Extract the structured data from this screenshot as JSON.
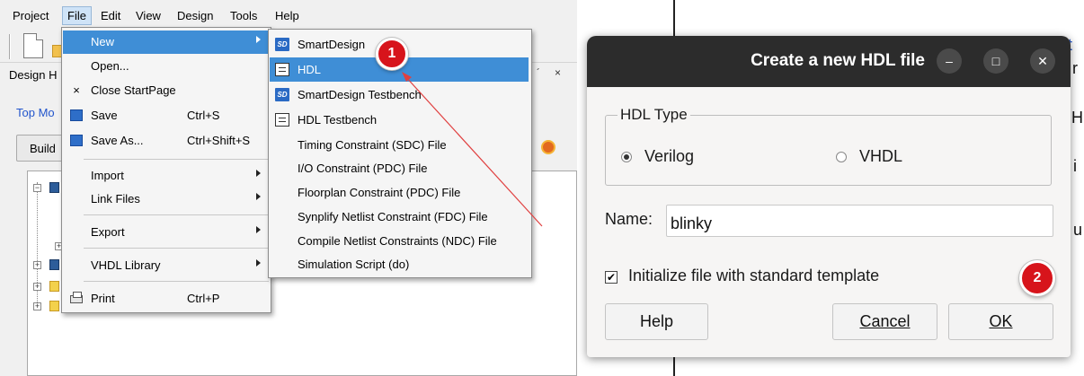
{
  "ide": {
    "menubar": [
      "Project",
      "File",
      "Edit",
      "View",
      "Design",
      "Tools",
      "Help"
    ],
    "design_hierarchy_label": "Design H",
    "top_module_label": "Top Mo",
    "build_label": "Build",
    "pane_ctrl_float": "´",
    "pane_ctrl_close": "×"
  },
  "file_menu": {
    "items": [
      {
        "label": "New",
        "shortcut": "",
        "submenu": true
      },
      {
        "label": "Open...",
        "shortcut": "",
        "submenu": false
      },
      {
        "label": "Close StartPage",
        "shortcut": "",
        "submenu": false
      },
      {
        "label": "Save",
        "shortcut": "Ctrl+S",
        "submenu": false
      },
      {
        "label": "Save  As...",
        "shortcut": "Ctrl+Shift+S",
        "submenu": false
      },
      {
        "label": "Import",
        "shortcut": "",
        "submenu": true
      },
      {
        "label": "Link Files",
        "shortcut": "",
        "submenu": true
      },
      {
        "label": "Export",
        "shortcut": "",
        "submenu": true
      },
      {
        "label": "VHDL Library",
        "shortcut": "",
        "submenu": true
      },
      {
        "label": "Print",
        "shortcut": "Ctrl+P",
        "submenu": false
      }
    ],
    "close_icon": "×"
  },
  "new_menu": {
    "items": [
      {
        "label": "SmartDesign",
        "icon": "smartdesign-icon"
      },
      {
        "label": "HDL",
        "icon": "hdl-document-icon"
      },
      {
        "label": "SmartDesign Testbench",
        "icon": "smartdesign-testbench-icon"
      },
      {
        "label": "HDL Testbench",
        "icon": "hdl-testbench-icon"
      },
      {
        "label": "Timing Constraint (SDC) File",
        "icon": ""
      },
      {
        "label": "I/O Constraint (PDC) File",
        "icon": ""
      },
      {
        "label": "Floorplan Constraint (PDC) File",
        "icon": ""
      },
      {
        "label": "Synplify Netlist Constraint (FDC) File",
        "icon": ""
      },
      {
        "label": "Compile Netlist Constraints (NDC) File",
        "icon": ""
      },
      {
        "label": "Simulation Script (do)",
        "icon": ""
      }
    ],
    "sd_icon_text": "SD",
    "sdtb_icon_text": "SD"
  },
  "annotations": {
    "step1": "1",
    "step2": "2",
    "accent": "#d7141b"
  },
  "background_fragments": [
    "t",
    "r",
    "H",
    "i",
    "u"
  ],
  "dialog": {
    "title": "Create a new HDL file",
    "minimize_glyph": "–",
    "maximize_glyph": "□",
    "close_glyph": "✕",
    "group_label": "HDL Type",
    "options": [
      {
        "label": "Verilog",
        "selected": true
      },
      {
        "label": "VHDL",
        "selected": false
      }
    ],
    "name_label": "Name:",
    "name_value": "blinky",
    "checkbox_label": "Initialize file with standard template",
    "checkbox_checked": true,
    "checkbox_glyph": "✔",
    "help_label": "Help",
    "cancel_label": "Cancel",
    "ok_label": "OK"
  },
  "colors": {
    "menu_highlight": "#3f8ed6",
    "titlebar": "#2c2c2c",
    "arrow": "#e04040"
  }
}
